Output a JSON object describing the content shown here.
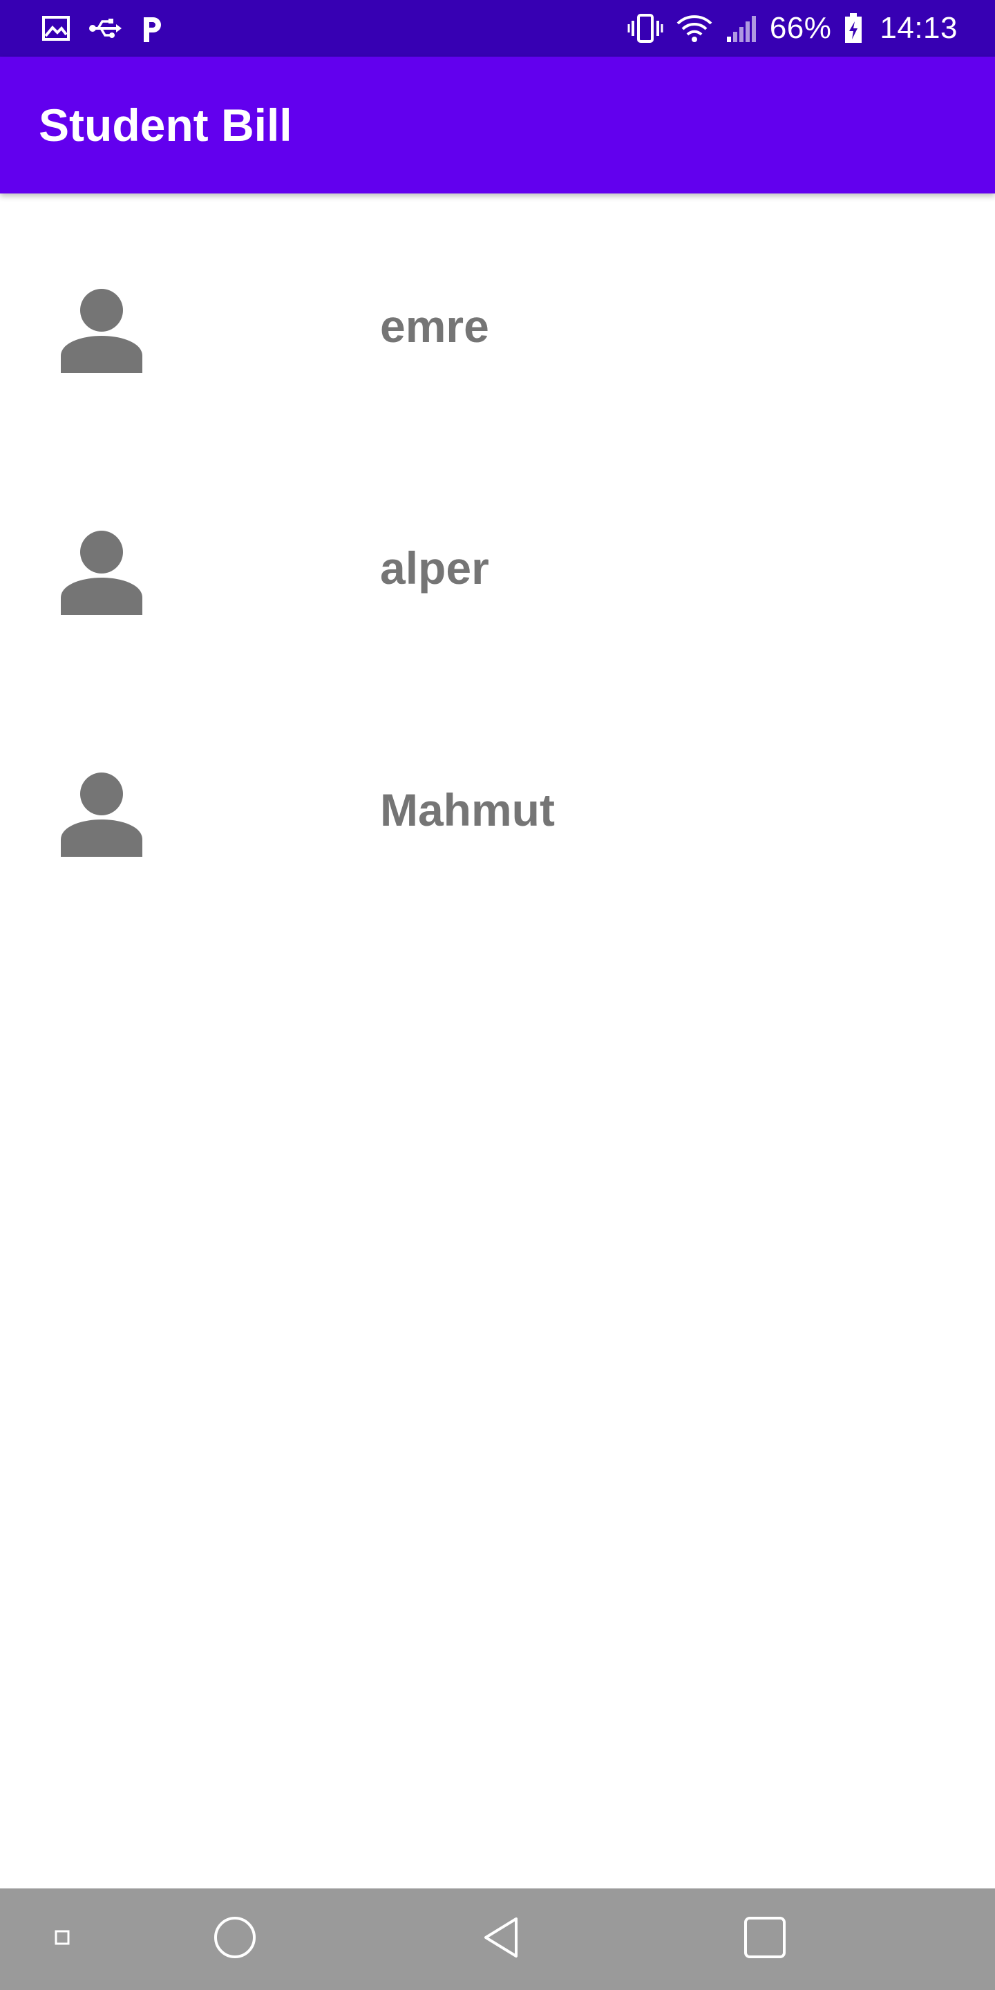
{
  "status_bar": {
    "left_icons": [
      "image-icon",
      "usb-icon",
      "p-icon"
    ],
    "right_icons": [
      "vibrate-icon",
      "wifi-icon",
      "signal-icon",
      "battery-icon"
    ],
    "battery_percent": "66%",
    "time": "14:13"
  },
  "app_bar": {
    "title": "Student Bill",
    "color": "#6200ee"
  },
  "students": [
    {
      "name": "emre",
      "icon": "person-icon"
    },
    {
      "name": "alper",
      "icon": "person-icon"
    },
    {
      "name": "Mahmut",
      "icon": "person-icon"
    }
  ],
  "nav_bar": {
    "buttons": [
      "small-square-icon",
      "home-circle-icon",
      "back-triangle-icon",
      "recents-square-icon"
    ]
  },
  "colors": {
    "status_bar": "#3700b3",
    "app_bar": "#6200ee",
    "text_secondary": "#757575",
    "nav_bar": "#9a9a9a"
  }
}
